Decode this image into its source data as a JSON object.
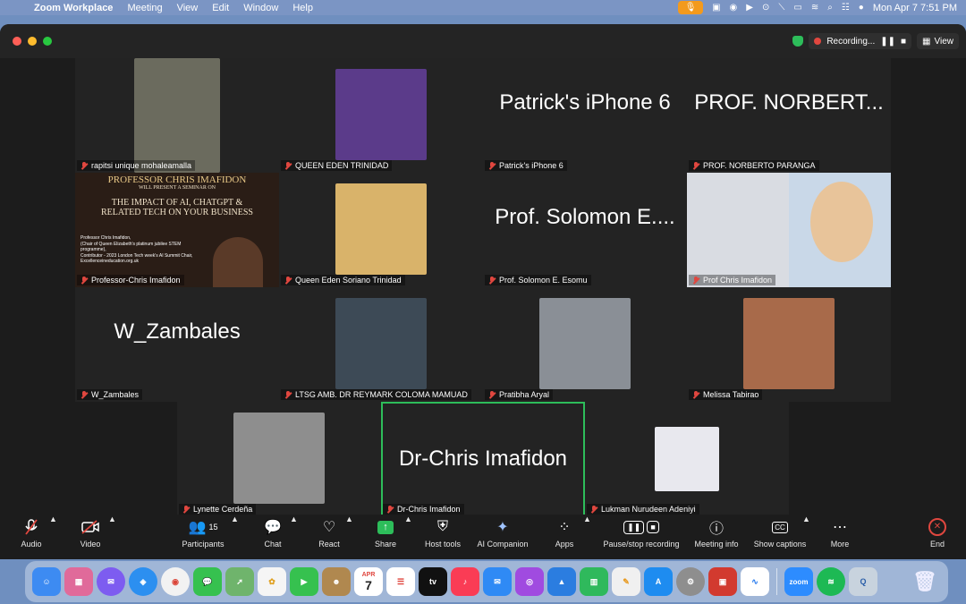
{
  "menubar": {
    "app_name": "Zoom Workplace",
    "items": [
      "Meeting",
      "View",
      "Edit",
      "Window",
      "Help"
    ],
    "clock": "Mon Apr 7  7:51 PM"
  },
  "titlebar": {
    "recording_label": "Recording...",
    "view_label": "View"
  },
  "tiles": [
    {
      "row": 0,
      "col": 0,
      "name": "rapitsi unique mohaleamalla",
      "big": "",
      "photo": "#6b6b5e"
    },
    {
      "row": 0,
      "col": 1,
      "name": "QUEEN EDEN TRINIDAD",
      "big": "",
      "photo": "#5b3b8a"
    },
    {
      "row": 0,
      "col": 2,
      "name": "Patrick's iPhone 6",
      "big": "Patrick's iPhone 6",
      "photo": ""
    },
    {
      "row": 0,
      "col": 3,
      "name": "PROF. NORBERTO PARANGA",
      "big": "PROF. NORBERT...",
      "photo": ""
    },
    {
      "row": 1,
      "col": 0,
      "name": "Professor-Chris Imafidon",
      "big": "",
      "photo": "share1"
    },
    {
      "row": 1,
      "col": 1,
      "name": "Queen Eden Soriano Trinidad",
      "big": "",
      "photo": "#d9b36a"
    },
    {
      "row": 1,
      "col": 2,
      "name": "Prof. Solomon E. Esomu",
      "big": "Prof. Solomon E....",
      "photo": ""
    },
    {
      "row": 1,
      "col": 3,
      "name": "Prof Chris Imafidon",
      "big": "",
      "photo": "share2"
    },
    {
      "row": 2,
      "col": 0,
      "name": "W_Zambales",
      "big": "W_Zambales",
      "photo": ""
    },
    {
      "row": 2,
      "col": 1,
      "name": "LTSG AMB. DR REYMARK COLOMA MAMUAD",
      "big": "",
      "photo": "#3d4a56"
    },
    {
      "row": 2,
      "col": 2,
      "name": "Pratibha Aryal",
      "big": "",
      "photo": "#8a8f96"
    },
    {
      "row": 2,
      "col": 3,
      "name": "Melissa Tabirao",
      "big": "",
      "photo": "#a86a4a"
    },
    {
      "row": 3,
      "col": 0,
      "name": "Lynette Cerdeña",
      "big": "",
      "photo": "#8e8e8e"
    },
    {
      "row": 3,
      "col": 1,
      "name": "Dr-Chris Imafidon",
      "big": "Dr-Chris Imafidon",
      "photo": "",
      "active": true
    },
    {
      "row": 3,
      "col": 2,
      "name": "Lukman Nurudeen Adeniyi",
      "big": "",
      "photo": "#e8e8ee"
    }
  ],
  "share_slide": {
    "heading": "PROFESSOR CHRIS IMAFIDON",
    "sub": "WILL PRESENT A SEMINAR ON",
    "title1": "THE IMPACT OF AI, CHATGPT &",
    "title2": "RELATED TECH ON YOUR BUSINESS",
    "body1": "Professor Chris Imafidon,",
    "body2": "(Chair of Queen Elizabeth's platinum jubilee STEM programme),",
    "body3": "Contributor - 2023 London Tech week's AI Summit Chair,",
    "body4": "Excellenceineducation.org.uk"
  },
  "toolbar": {
    "audio": "Audio",
    "video": "Video",
    "participants": "Participants",
    "participants_count": "15",
    "chat": "Chat",
    "react": "React",
    "share": "Share",
    "host_tools": "Host tools",
    "ai_companion": "AI Companion",
    "apps": "Apps",
    "pause_stop": "Pause/stop recording",
    "meeting_info": "Meeting info",
    "show_captions": "Show captions",
    "more": "More",
    "end": "End"
  },
  "dock": {
    "calendar_month": "APR",
    "calendar_day": "7",
    "tv_label": "tv",
    "zoom_label": "zoom"
  },
  "colors": {
    "accent_green": "#2dbd5a",
    "mute_red": "#e0473f",
    "recording_red": "#e0473f",
    "mic_orange": "#f39a1d"
  }
}
